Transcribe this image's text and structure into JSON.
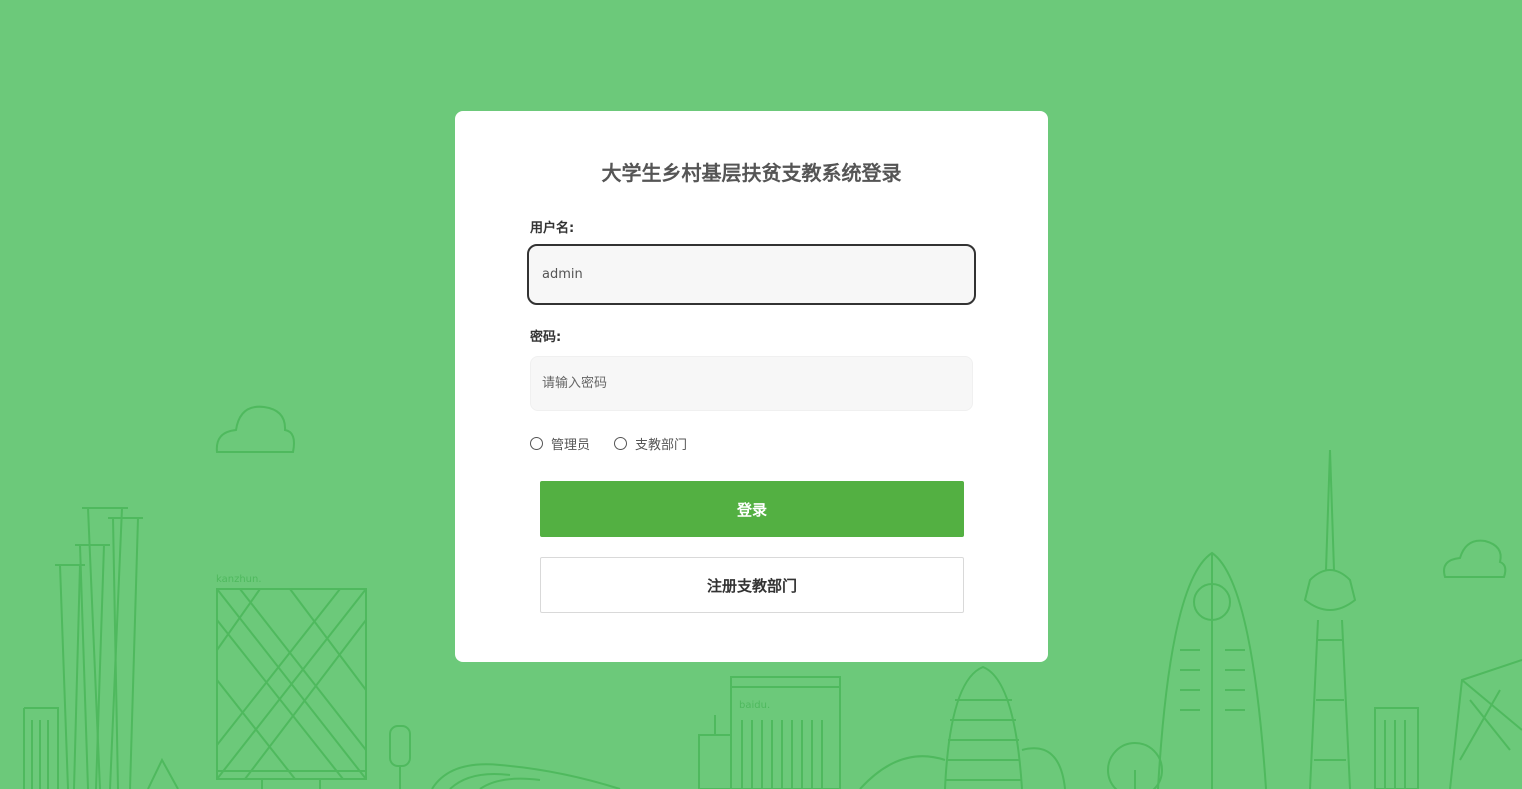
{
  "login": {
    "title": "大学生乡村基层扶贫支教系统登录",
    "username_label": "用户名:",
    "username_value": "admin",
    "password_label": "密码:",
    "password_placeholder": "请输入密码",
    "roles": [
      "管理员",
      "支教部门"
    ],
    "login_button": "登录",
    "register_button": "注册支教部门"
  },
  "background": {
    "sign_left": "kanzhun.",
    "sign_center": "baidu.",
    "colors": {
      "bg": "#6cc97a",
      "line": "#4fb95e",
      "primary_button": "#53b042"
    }
  }
}
